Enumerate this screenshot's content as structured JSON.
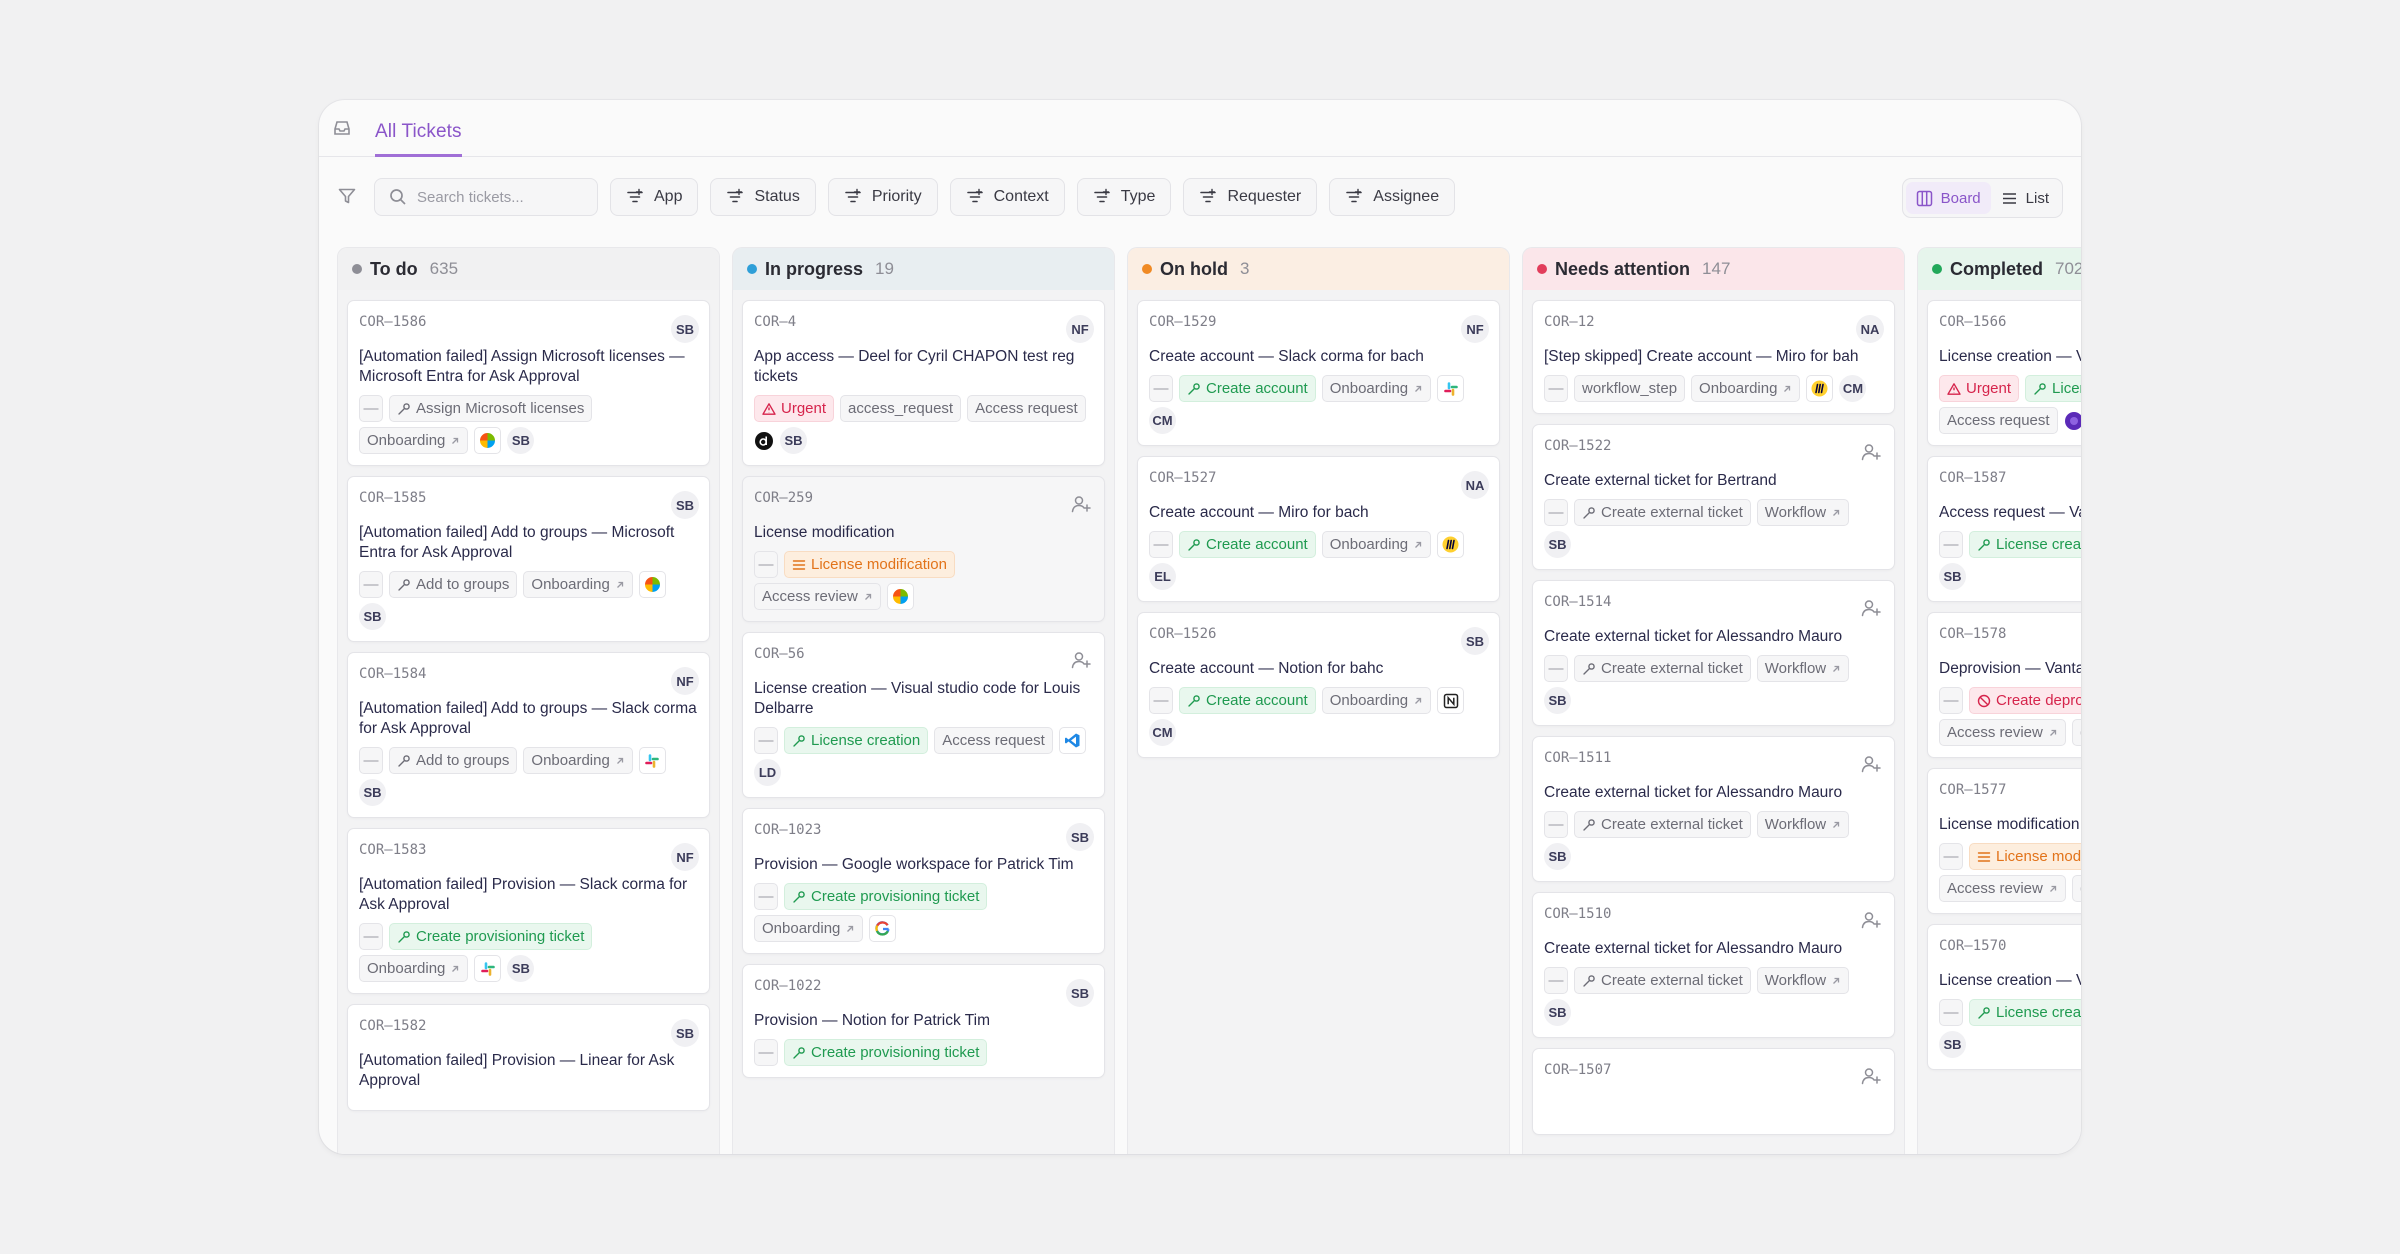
{
  "tabs": {
    "all_tickets": "All Tickets"
  },
  "search": {
    "placeholder": "Search tickets..."
  },
  "filters": [
    "App",
    "Status",
    "Priority",
    "Context",
    "Type",
    "Requester",
    "Assignee"
  ],
  "view": {
    "board": "Board",
    "list": "List",
    "active": "Board"
  },
  "colors": {
    "accent": "#8a55c9",
    "todo": "#8e8e96",
    "in_progress": "#2f9fd8",
    "on_hold": "#f08a24",
    "needs_attention": "#e23d5b",
    "completed": "#22a85a"
  },
  "columns": [
    {
      "name": "To do",
      "count": "635",
      "color": "#8e8e96",
      "bg": "#f1f1f2",
      "cards": [
        {
          "id": "COR–1586",
          "avatar": "SB",
          "title": "[Automation failed] Assign Microsoft licenses — Microsoft Entra for Ask Approval",
          "rows": [
            [
              {
                "t": "dash"
              },
              {
                "t": "chip",
                "icon": "wrench-icon",
                "label": "Assign Microsoft licenses"
              }
            ],
            [
              {
                "t": "chip",
                "label": "Onboarding",
                "ext": true
              },
              {
                "t": "icon",
                "name": "microsoft-icon"
              },
              {
                "t": "ini",
                "label": "SB"
              }
            ]
          ]
        },
        {
          "id": "COR–1585",
          "avatar": "SB",
          "title": "[Automation failed] Add to groups — Microsoft Entra for Ask Approval",
          "rows": [
            [
              {
                "t": "dash"
              },
              {
                "t": "chip",
                "icon": "wrench-icon",
                "label": "Add to groups"
              },
              {
                "t": "chip",
                "label": "Onboarding",
                "ext": true
              },
              {
                "t": "icon",
                "name": "microsoft-icon"
              }
            ],
            [
              {
                "t": "ini",
                "label": "SB"
              }
            ]
          ]
        },
        {
          "id": "COR–1584",
          "avatar": "NF",
          "title": "[Automation failed] Add to groups — Slack corma for Ask Approval",
          "rows": [
            [
              {
                "t": "dash"
              },
              {
                "t": "chip",
                "icon": "wrench-icon",
                "label": "Add to groups"
              },
              {
                "t": "chip",
                "label": "Onboarding",
                "ext": true
              },
              {
                "t": "icon",
                "name": "slack-icon"
              }
            ],
            [
              {
                "t": "ini",
                "label": "SB"
              }
            ]
          ]
        },
        {
          "id": "COR–1583",
          "avatar": "NF",
          "title": "[Automation failed] Provision — Slack corma for Ask Approval",
          "rows": [
            [
              {
                "t": "dash"
              },
              {
                "t": "chip",
                "style": "green",
                "icon": "wrench-icon",
                "label": "Create provisioning ticket"
              }
            ],
            [
              {
                "t": "chip",
                "label": "Onboarding",
                "ext": true
              },
              {
                "t": "icon",
                "name": "slack-icon"
              },
              {
                "t": "ini",
                "label": "SB"
              }
            ]
          ]
        },
        {
          "id": "COR–1582",
          "avatar": "SB",
          "title": "[Automation failed] Provision — Linear for Ask Approval",
          "rows": []
        }
      ]
    },
    {
      "name": "In progress",
      "count": "19",
      "color": "#2f9fd8",
      "bg": "#e8eef1",
      "cards": [
        {
          "id": "COR–4",
          "avatar": "NF",
          "title": "App access — Deel for Cyril CHAPON test reg tickets",
          "rows": [
            [
              {
                "t": "chip",
                "style": "red",
                "icon": "warning-icon",
                "label": "Urgent"
              },
              {
                "t": "chip",
                "label": "access_request"
              },
              {
                "t": "chip",
                "label": "Access request"
              }
            ],
            [
              {
                "t": "icon",
                "name": "deel-icon",
                "bare": true
              },
              {
                "t": "ini",
                "label": "SB"
              }
            ]
          ]
        },
        {
          "id": "COR–259",
          "assign": true,
          "gray": true,
          "title": "License modification",
          "rows": [
            [
              {
                "t": "dash"
              },
              {
                "t": "chip",
                "style": "orange",
                "icon": "list-icon",
                "label": "License modification"
              }
            ],
            [
              {
                "t": "chip",
                "label": "Access review",
                "ext": true
              },
              {
                "t": "icon",
                "name": "microsoft-icon"
              }
            ]
          ]
        },
        {
          "id": "COR–56",
          "assign": true,
          "title": "License creation — Visual studio code for Louis Delbarre",
          "rows": [
            [
              {
                "t": "dash"
              },
              {
                "t": "chip",
                "style": "green",
                "icon": "wrench-icon",
                "label": "License creation"
              },
              {
                "t": "chip",
                "label": "Access request"
              },
              {
                "t": "icon",
                "name": "vscode-icon"
              }
            ],
            [
              {
                "t": "ini",
                "label": "LD"
              }
            ]
          ]
        },
        {
          "id": "COR–1023",
          "avatar": "SB",
          "title": "Provision — Google workspace for Patrick Tim",
          "rows": [
            [
              {
                "t": "dash"
              },
              {
                "t": "chip",
                "style": "green",
                "icon": "wrench-icon",
                "label": "Create provisioning ticket"
              }
            ],
            [
              {
                "t": "chip",
                "label": "Onboarding",
                "ext": true
              },
              {
                "t": "icon",
                "name": "google-icon"
              }
            ]
          ]
        },
        {
          "id": "COR–1022",
          "avatar": "SB",
          "title": "Provision — Notion for Patrick Tim",
          "rows": [
            [
              {
                "t": "dash"
              },
              {
                "t": "chip",
                "style": "green",
                "icon": "wrench-icon",
                "label": "Create provisioning ticket"
              }
            ]
          ]
        }
      ]
    },
    {
      "name": "On hold",
      "count": "3",
      "color": "#f08a24",
      "bg": "#fbeee3",
      "cards": [
        {
          "id": "COR–1529",
          "avatar": "NF",
          "title": "Create account — Slack corma for bach",
          "rows": [
            [
              {
                "t": "dash"
              },
              {
                "t": "chip",
                "style": "green",
                "icon": "wrench-icon",
                "label": "Create account"
              },
              {
                "t": "chip",
                "label": "Onboarding",
                "ext": true
              },
              {
                "t": "icon",
                "name": "slack-icon"
              }
            ],
            [
              {
                "t": "ini",
                "label": "CM"
              }
            ]
          ]
        },
        {
          "id": "COR–1527",
          "avatar": "NA",
          "title": "Create account — Miro for bach",
          "rows": [
            [
              {
                "t": "dash"
              },
              {
                "t": "chip",
                "style": "green",
                "icon": "wrench-icon",
                "label": "Create account"
              },
              {
                "t": "chip",
                "label": "Onboarding",
                "ext": true
              },
              {
                "t": "icon",
                "name": "miro-icon"
              }
            ],
            [
              {
                "t": "ini",
                "label": "EL"
              }
            ]
          ]
        },
        {
          "id": "COR–1526",
          "avatar": "SB",
          "title": "Create account — Notion for bahc",
          "rows": [
            [
              {
                "t": "dash"
              },
              {
                "t": "chip",
                "style": "green",
                "icon": "wrench-icon",
                "label": "Create account"
              },
              {
                "t": "chip",
                "label": "Onboarding",
                "ext": true
              },
              {
                "t": "icon",
                "name": "notion-icon"
              }
            ],
            [
              {
                "t": "ini",
                "label": "CM"
              }
            ]
          ]
        }
      ]
    },
    {
      "name": "Needs attention",
      "count": "147",
      "color": "#e23d5b",
      "bg": "#fbe6ea",
      "cards": [
        {
          "id": "COR–12",
          "avatar": "NA",
          "title": "[Step skipped] Create account — Miro for bah",
          "rows": [
            [
              {
                "t": "dash"
              },
              {
                "t": "chip",
                "label": "workflow_step"
              },
              {
                "t": "chip",
                "label": "Onboarding",
                "ext": true
              },
              {
                "t": "icon",
                "name": "miro-icon"
              },
              {
                "t": "ini",
                "label": "CM"
              }
            ]
          ]
        },
        {
          "id": "COR–1522",
          "assign": true,
          "title": "Create external ticket for Bertrand",
          "rows": [
            [
              {
                "t": "dash"
              },
              {
                "t": "chip",
                "icon": "wrench-icon",
                "label": "Create external ticket"
              },
              {
                "t": "chip",
                "label": "Workflow",
                "ext": true
              }
            ],
            [
              {
                "t": "ini",
                "label": "SB"
              }
            ]
          ]
        },
        {
          "id": "COR–1514",
          "assign": true,
          "title": "Create external ticket for Alessandro Mauro",
          "rows": [
            [
              {
                "t": "dash"
              },
              {
                "t": "chip",
                "icon": "wrench-icon",
                "label": "Create external ticket"
              },
              {
                "t": "chip",
                "label": "Workflow",
                "ext": true
              }
            ],
            [
              {
                "t": "ini",
                "label": "SB"
              }
            ]
          ]
        },
        {
          "id": "COR–1511",
          "assign": true,
          "title": "Create external ticket for Alessandro Mauro",
          "rows": [
            [
              {
                "t": "dash"
              },
              {
                "t": "chip",
                "icon": "wrench-icon",
                "label": "Create external ticket"
              },
              {
                "t": "chip",
                "label": "Workflow",
                "ext": true
              }
            ],
            [
              {
                "t": "ini",
                "label": "SB"
              }
            ]
          ]
        },
        {
          "id": "COR–1510",
          "assign": true,
          "title": "Create external ticket for Alessandro Mauro",
          "rows": [
            [
              {
                "t": "dash"
              },
              {
                "t": "chip",
                "icon": "wrench-icon",
                "label": "Create external ticket"
              },
              {
                "t": "chip",
                "label": "Workflow",
                "ext": true
              }
            ],
            [
              {
                "t": "ini",
                "label": "SB"
              }
            ]
          ]
        },
        {
          "id": "COR–1507",
          "assign": true,
          "title": "",
          "rows": []
        }
      ]
    },
    {
      "name": "Completed",
      "count": "702",
      "color": "#22a85a",
      "bg": "#e6f5ec",
      "cards": [
        {
          "id": "COR–1566",
          "title": "License creation — Va",
          "rows": [
            [
              {
                "t": "chip",
                "style": "red",
                "icon": "warning-icon",
                "label": "Urgent"
              },
              {
                "t": "chip",
                "style": "green",
                "icon": "wrench-icon",
                "label": "Licen"
              }
            ],
            [
              {
                "t": "chip",
                "label": "Access request"
              },
              {
                "t": "icon",
                "name": "purple-app-icon",
                "bare": true
              }
            ]
          ]
        },
        {
          "id": "COR–1587",
          "title": "Access request — Var",
          "rows": [
            [
              {
                "t": "dash"
              },
              {
                "t": "chip",
                "style": "green",
                "icon": "wrench-icon",
                "label": "License crea"
              }
            ],
            [
              {
                "t": "ini",
                "label": "SB"
              }
            ]
          ]
        },
        {
          "id": "COR–1578",
          "title": "Deprovision — Vanta f",
          "rows": [
            [
              {
                "t": "dash"
              },
              {
                "t": "chip",
                "style": "red",
                "icon": "ban-icon",
                "label": "Create depro"
              }
            ],
            [
              {
                "t": "chip",
                "label": "Access review",
                "ext": true
              },
              {
                "t": "chip",
                "label": "("
              }
            ]
          ]
        },
        {
          "id": "COR–1577",
          "title": "License modification",
          "rows": [
            [
              {
                "t": "dash"
              },
              {
                "t": "chip",
                "style": "orange",
                "icon": "list-icon",
                "label": "License mod"
              }
            ],
            [
              {
                "t": "chip",
                "label": "Access review",
                "ext": true
              },
              {
                "t": "chip",
                "label": "("
              }
            ]
          ]
        },
        {
          "id": "COR–1570",
          "title": "License creation — Va",
          "rows": [
            [
              {
                "t": "dash"
              },
              {
                "t": "chip",
                "style": "green",
                "icon": "wrench-icon",
                "label": "License crea"
              }
            ],
            [
              {
                "t": "ini",
                "label": "SB"
              }
            ]
          ]
        }
      ]
    }
  ]
}
